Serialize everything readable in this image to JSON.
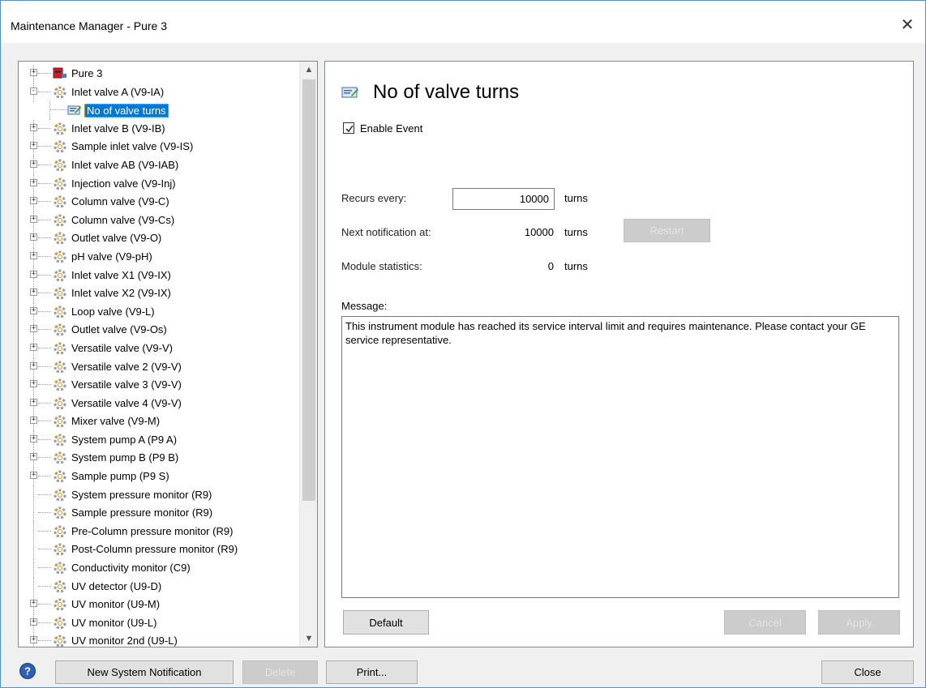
{
  "window": {
    "title": "Maintenance Manager - Pure 3",
    "close_glyph": "✕"
  },
  "tree": {
    "items": [
      {
        "label": "Pure 3",
        "indent": 0,
        "expander": "+",
        "icon": "system-icon"
      },
      {
        "label": "Inlet valve A (V9-IA)",
        "indent": 0,
        "expander": "−",
        "icon": "module-icon"
      },
      {
        "label": "No of valve turns",
        "indent": 1,
        "expander": "",
        "icon": "event-icon",
        "selected": true
      },
      {
        "label": "Inlet valve B (V9-IB)",
        "indent": 0,
        "expander": "+",
        "icon": "module-icon"
      },
      {
        "label": "Sample inlet valve (V9-IS)",
        "indent": 0,
        "expander": "+",
        "icon": "module-icon"
      },
      {
        "label": "Inlet valve AB (V9-IAB)",
        "indent": 0,
        "expander": "+",
        "icon": "module-icon"
      },
      {
        "label": "Injection valve (V9-Inj)",
        "indent": 0,
        "expander": "+",
        "icon": "module-icon"
      },
      {
        "label": "Column valve (V9-C)",
        "indent": 0,
        "expander": "+",
        "icon": "module-icon"
      },
      {
        "label": "Column valve (V9-Cs)",
        "indent": 0,
        "expander": "+",
        "icon": "module-icon"
      },
      {
        "label": "Outlet valve (V9-O)",
        "indent": 0,
        "expander": "+",
        "icon": "module-icon"
      },
      {
        "label": "pH valve (V9-pH)",
        "indent": 0,
        "expander": "+",
        "icon": "module-icon"
      },
      {
        "label": "Inlet valve X1 (V9-IX)",
        "indent": 0,
        "expander": "+",
        "icon": "module-icon"
      },
      {
        "label": "Inlet valve X2 (V9-IX)",
        "indent": 0,
        "expander": "+",
        "icon": "module-icon"
      },
      {
        "label": "Loop valve (V9-L)",
        "indent": 0,
        "expander": "+",
        "icon": "module-icon"
      },
      {
        "label": "Outlet valve (V9-Os)",
        "indent": 0,
        "expander": "+",
        "icon": "module-icon"
      },
      {
        "label": "Versatile valve (V9-V)",
        "indent": 0,
        "expander": "+",
        "icon": "module-icon"
      },
      {
        "label": "Versatile valve 2 (V9-V)",
        "indent": 0,
        "expander": "+",
        "icon": "module-icon"
      },
      {
        "label": "Versatile valve 3 (V9-V)",
        "indent": 0,
        "expander": "+",
        "icon": "module-icon"
      },
      {
        "label": "Versatile valve 4 (V9-V)",
        "indent": 0,
        "expander": "+",
        "icon": "module-icon"
      },
      {
        "label": "Mixer valve (V9-M)",
        "indent": 0,
        "expander": "+",
        "icon": "module-icon"
      },
      {
        "label": "System pump A (P9 A)",
        "indent": 0,
        "expander": "+",
        "icon": "module-icon"
      },
      {
        "label": "System pump B (P9 B)",
        "indent": 0,
        "expander": "+",
        "icon": "module-icon"
      },
      {
        "label": "Sample pump (P9 S)",
        "indent": 0,
        "expander": "+",
        "icon": "module-icon"
      },
      {
        "label": "System pressure monitor (R9)",
        "indent": 0,
        "expander": "",
        "icon": "module-icon"
      },
      {
        "label": "Sample pressure monitor (R9)",
        "indent": 0,
        "expander": "",
        "icon": "module-icon"
      },
      {
        "label": "Pre-Column pressure monitor (R9)",
        "indent": 0,
        "expander": "",
        "icon": "module-icon"
      },
      {
        "label": "Post-Column pressure monitor (R9)",
        "indent": 0,
        "expander": "",
        "icon": "module-icon"
      },
      {
        "label": "Conductivity monitor (C9)",
        "indent": 0,
        "expander": "",
        "icon": "module-icon"
      },
      {
        "label": "UV detector (U9-D)",
        "indent": 0,
        "expander": "",
        "icon": "module-icon"
      },
      {
        "label": "UV monitor (U9-M)",
        "indent": 0,
        "expander": "+",
        "icon": "module-icon"
      },
      {
        "label": "UV monitor (U9-L)",
        "indent": 0,
        "expander": "+",
        "icon": "module-icon"
      },
      {
        "label": "UV monitor 2nd (U9-L)",
        "indent": 0,
        "expander": "+",
        "icon": "module-icon"
      }
    ]
  },
  "detail": {
    "title": "No of valve turns",
    "enable_event_label": "Enable Event",
    "enable_event_checked": true,
    "recurs_label": "Recurs every:",
    "recurs_value": "10000",
    "recurs_unit": "turns",
    "next_label": "Next notification at:",
    "next_value": "10000",
    "next_unit": "turns",
    "restart_label": "Restart",
    "stats_label": "Module statistics:",
    "stats_value": "0",
    "stats_unit": "turns",
    "message_label": "Message:",
    "message_text": "This instrument module has reached its service interval limit and requires maintenance. Please contact your GE service representative.",
    "default_label": "Default",
    "cancel_label": "Cancel",
    "apply_label": "Apply"
  },
  "footer": {
    "new_notification_label": "New System Notification",
    "delete_label": "Delete",
    "print_label": "Print...",
    "close_label": "Close"
  },
  "colors": {
    "selection": "#0078d7",
    "window_border": "#5a8fc6"
  }
}
